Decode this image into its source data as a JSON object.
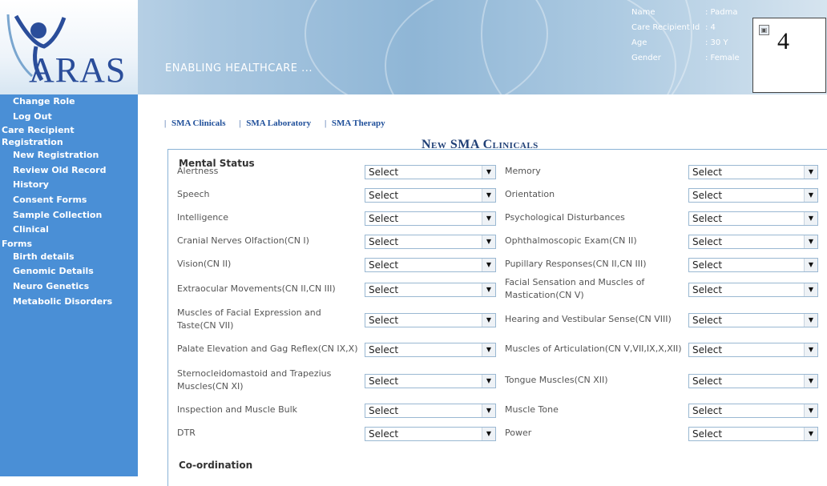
{
  "header": {
    "logo_text": "ARAS",
    "tagline": "ENABLING HEALTHCARE ...",
    "patient": [
      {
        "label": "Name",
        "value": ": Padma"
      },
      {
        "label": "Care Recipient Id",
        "value": ": 4"
      },
      {
        "label": "Age",
        "value": ": 30 Y"
      },
      {
        "label": "Gender",
        "value": ": Female"
      }
    ],
    "photo_number": "4"
  },
  "sidebar": {
    "items": [
      {
        "type": "item",
        "label": "Change Role"
      },
      {
        "type": "item",
        "label": "Log Out"
      },
      {
        "type": "head",
        "label": "Care Recipient"
      },
      {
        "type": "head",
        "label": "Registration"
      },
      {
        "type": "item",
        "label": "New Registration"
      },
      {
        "type": "item",
        "label": "Review Old Record"
      },
      {
        "type": "item",
        "label": "History"
      },
      {
        "type": "item",
        "label": "Consent Forms"
      },
      {
        "type": "item",
        "label": "Sample Collection"
      },
      {
        "type": "item",
        "label": "Clinical"
      },
      {
        "type": "head",
        "label": "Forms"
      },
      {
        "type": "item",
        "label": "Birth details"
      },
      {
        "type": "item",
        "label": "Genomic Details"
      },
      {
        "type": "item",
        "label": "Neuro Genetics"
      },
      {
        "type": "item",
        "label": "Metabolic Disorders"
      }
    ]
  },
  "tabs": [
    "SMA Clinicals",
    "SMA Laboratory",
    "SMA Therapy"
  ],
  "form_title": "New SMA Clinicals",
  "sections": {
    "mental_status": "Mental Status",
    "coordination": "Co-ordination"
  },
  "fields": [
    {
      "left": "Alertness",
      "left_value": "Select",
      "right": "Memory",
      "right_value": "Select"
    },
    {
      "left": "Speech",
      "left_value": "Select",
      "right": "Orientation",
      "right_value": "Select"
    },
    {
      "left": "Intelligence",
      "left_value": "Select",
      "right": "Psychological Disturbances",
      "right_value": "Select"
    },
    {
      "left": "Cranial Nerves Olfaction(CN I)",
      "left_value": "Select",
      "right": "Ophthalmoscopic Exam(CN II)",
      "right_value": "Select"
    },
    {
      "left": "Vision(CN II)",
      "left_value": "Select",
      "right": "Pupillary Responses(CN II,CN III)",
      "right_value": "Select"
    },
    {
      "left": "Extraocular Movements(CN II,CN III)",
      "left_value": "Select",
      "right": "Facial Sensation and Muscles of Mastication(CN V)",
      "right_value": "Select"
    },
    {
      "left": "Muscles of Facial Expression and Taste(CN VII)",
      "left_value": "Select",
      "right": "Hearing and Vestibular Sense(CN VIII)",
      "right_value": "Select"
    },
    {
      "left": "Palate Elevation and Gag Reflex(CN IX,X)",
      "left_value": "Select",
      "right": "Muscles of Articulation(CN V,VII,IX,X,XII)",
      "right_value": "Select"
    },
    {
      "left": "Sternocleidomastoid and Trapezius Muscles(CN XI)",
      "left_value": "Select",
      "right": "Tongue Muscles(CN XII)",
      "right_value": "Select"
    },
    {
      "left": "Inspection and Muscle Bulk",
      "left_value": "Select",
      "right": "Muscle Tone",
      "right_value": "Select"
    },
    {
      "left": "DTR",
      "left_value": "Select",
      "right": "Power",
      "right_value": "Select"
    }
  ]
}
